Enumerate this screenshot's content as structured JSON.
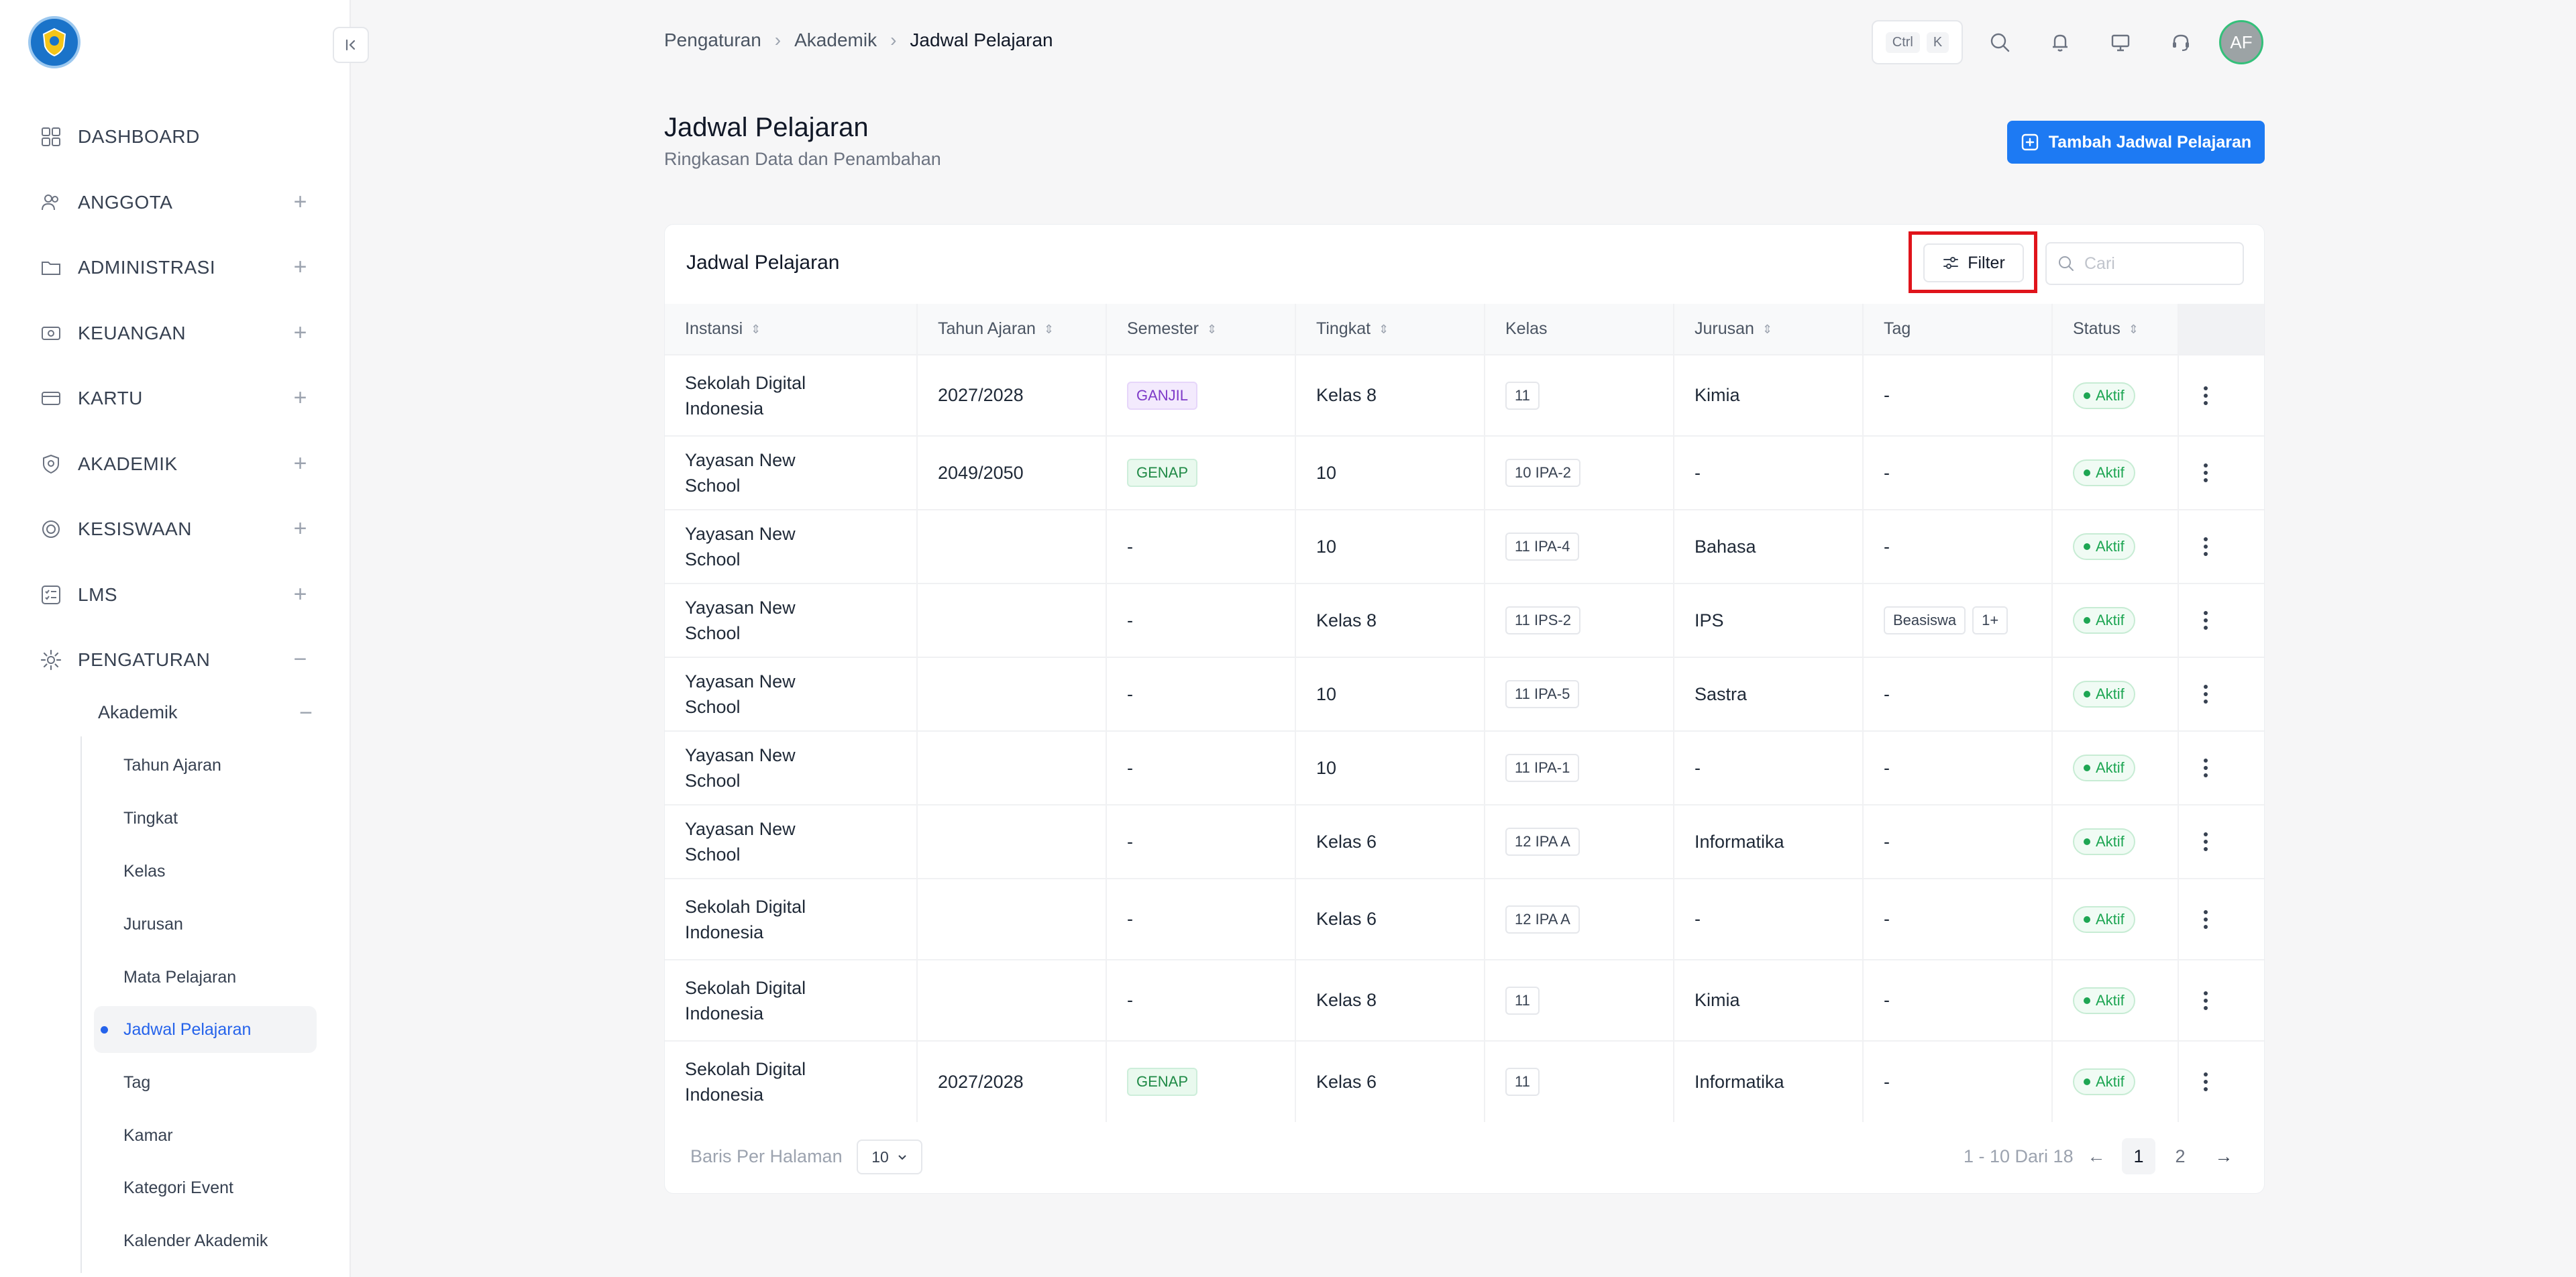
{
  "sidebar": {
    "menu": [
      {
        "label": "DASHBOARD",
        "icon": "grid-icon",
        "toggle": ""
      },
      {
        "label": "ANGGOTA",
        "icon": "users-icon",
        "toggle": "+"
      },
      {
        "label": "ADMINISTRASI",
        "icon": "folder-icon",
        "toggle": "+"
      },
      {
        "label": "KEUANGAN",
        "icon": "money-icon",
        "toggle": "+"
      },
      {
        "label": "KARTU",
        "icon": "card-icon",
        "toggle": "+"
      },
      {
        "label": "AKADEMIK",
        "icon": "shield-icon",
        "toggle": "+"
      },
      {
        "label": "KESISWAAN",
        "icon": "student-icon",
        "toggle": "+"
      },
      {
        "label": "LMS",
        "icon": "checklist-icon",
        "toggle": "+"
      },
      {
        "label": "PENGATURAN",
        "icon": "gear-icon",
        "toggle": "−"
      }
    ],
    "submenu_title": "Akademik",
    "submenu_toggle": "−",
    "submenu_items": [
      "Tahun Ajaran",
      "Tingkat",
      "Kelas",
      "Jurusan",
      "Mata Pelajaran",
      "Jadwal Pelajaran",
      "Tag",
      "Kamar",
      "Kategori Event",
      "Kalender Akademik"
    ],
    "active_item": "Jadwal Pelajaran"
  },
  "breadcrumb": [
    "Pengaturan",
    "Akademik",
    "Jadwal Pelajaran"
  ],
  "shortcut": {
    "key1": "Ctrl",
    "key2": "K"
  },
  "avatar": "AF",
  "header": {
    "title": "Jadwal Pelajaran",
    "subtitle": "Ringkasan Data dan Penambahan",
    "add_button": "Tambah Jadwal Pelajaran"
  },
  "table_card": {
    "title": "Jadwal Pelajaran",
    "filter_label": "Filter",
    "search_placeholder": "Cari",
    "columns": [
      "Instansi",
      "Tahun Ajaran",
      "Semester",
      "Tingkat",
      "Kelas",
      "Jurusan",
      "Tag",
      "Status"
    ],
    "rows": [
      {
        "instansi": "Sekolah Digital Indonesia",
        "tahun": "2027/2028",
        "semester": "GANJIL",
        "tingkat": "Kelas 8",
        "kelas": "11",
        "jurusan": "Kimia",
        "tag": "-",
        "tag_extra": "",
        "status": "Aktif"
      },
      {
        "instansi": "Yayasan New School",
        "tahun": "2049/2050",
        "semester": "GENAP",
        "tingkat": "10",
        "kelas": "10 IPA-2",
        "jurusan": "-",
        "tag": "-",
        "tag_extra": "",
        "status": "Aktif"
      },
      {
        "instansi": "Yayasan New School",
        "tahun": "",
        "semester": "-",
        "tingkat": "10",
        "kelas": "11 IPA-4",
        "jurusan": "Bahasa",
        "tag": "-",
        "tag_extra": "",
        "status": "Aktif"
      },
      {
        "instansi": "Yayasan New School",
        "tahun": "",
        "semester": "-",
        "tingkat": "Kelas 8",
        "kelas": "11 IPS-2",
        "jurusan": "IPS",
        "tag": "Beasiswa",
        "tag_extra": "1+",
        "status": "Aktif"
      },
      {
        "instansi": "Yayasan New School",
        "tahun": "",
        "semester": "-",
        "tingkat": "10",
        "kelas": "11 IPA-5",
        "jurusan": "Sastra",
        "tag": "-",
        "tag_extra": "",
        "status": "Aktif"
      },
      {
        "instansi": "Yayasan New School",
        "tahun": "",
        "semester": "-",
        "tingkat": "10",
        "kelas": "11 IPA-1",
        "jurusan": "-",
        "tag": "-",
        "tag_extra": "",
        "status": "Aktif"
      },
      {
        "instansi": "Yayasan New School",
        "tahun": "",
        "semester": "-",
        "tingkat": "Kelas 6",
        "kelas": "12 IPA A",
        "jurusan": "Informatika",
        "tag": "-",
        "tag_extra": "",
        "status": "Aktif"
      },
      {
        "instansi": "Sekolah Digital Indonesia",
        "tahun": "",
        "semester": "-",
        "tingkat": "Kelas 6",
        "kelas": "12 IPA A",
        "jurusan": "-",
        "tag": "-",
        "tag_extra": "",
        "status": "Aktif"
      },
      {
        "instansi": "Sekolah Digital Indonesia",
        "tahun": "",
        "semester": "-",
        "tingkat": "Kelas 8",
        "kelas": "11",
        "jurusan": "Kimia",
        "tag": "-",
        "tag_extra": "",
        "status": "Aktif"
      },
      {
        "instansi": "Sekolah Digital Indonesia",
        "tahun": "2027/2028",
        "semester": "GENAP",
        "tingkat": "Kelas 6",
        "kelas": "11",
        "jurusan": "Informatika",
        "tag": "-",
        "tag_extra": "",
        "status": "Aktif"
      }
    ]
  },
  "pagination": {
    "per_page_label": "Baris Per Halaman",
    "per_page_value": "10",
    "range_text": "1 - 10 Dari 18",
    "prev": "←",
    "pages": [
      "1",
      "2"
    ],
    "current_page": "1",
    "next": "→"
  },
  "colors": {
    "primary": "#1d7af3",
    "success": "#1ea653",
    "highlight_box": "#e0141b"
  }
}
